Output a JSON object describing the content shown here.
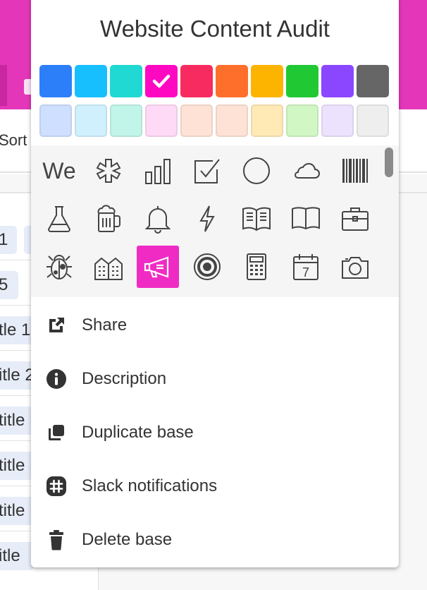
{
  "background": {
    "toolbar_text": "Sort",
    "cells": [
      {
        "text": "1"
      },
      {
        "text": ""
      },
      {
        "text": "5"
      },
      {
        "text": "tle 1"
      },
      {
        "text": "itle 2"
      },
      {
        "text": "title"
      },
      {
        "text": "title"
      },
      {
        "text": "title"
      },
      {
        "text": "itle"
      }
    ]
  },
  "popup": {
    "title": "Website Content Audit",
    "colors": {
      "dark": [
        "#2d7ff9",
        "#18bfff",
        "#20d9d2",
        "#ff08c2",
        "#f82b60",
        "#ff6f2c",
        "#fcb400",
        "#20c933",
        "#8b46ff",
        "#666666"
      ],
      "light": [
        "#cfdfff",
        "#d0f0fd",
        "#c2f5e9",
        "#ffdaf6",
        "#fee2d5",
        "#fee2d5",
        "#ffeab6",
        "#d1f7c4",
        "#ede2fe",
        "#eeeeee"
      ],
      "selected": "#ff08c2"
    },
    "icons": [
      {
        "name": "text-abbrev-icon",
        "text": "We"
      },
      {
        "name": "asterisk-icon"
      },
      {
        "name": "bar-chart-icon"
      },
      {
        "name": "checkbox-icon"
      },
      {
        "name": "circle-icon"
      },
      {
        "name": "cloud-icon"
      },
      {
        "name": "barcode-icon"
      },
      {
        "name": "flask-icon"
      },
      {
        "name": "beer-mug-icon"
      },
      {
        "name": "bell-icon"
      },
      {
        "name": "lightning-icon"
      },
      {
        "name": "open-book-icon"
      },
      {
        "name": "book-icon"
      },
      {
        "name": "briefcase-icon"
      },
      {
        "name": "bug-icon"
      },
      {
        "name": "buildings-icon"
      },
      {
        "name": "megaphone-icon",
        "selected": true
      },
      {
        "name": "target-icon"
      },
      {
        "name": "calculator-icon"
      },
      {
        "name": "calendar-icon",
        "text": "7"
      },
      {
        "name": "camera-icon"
      }
    ],
    "menu": [
      {
        "name": "share-icon",
        "label": "Share"
      },
      {
        "name": "info-icon",
        "label": "Description"
      },
      {
        "name": "duplicate-icon",
        "label": "Duplicate base"
      },
      {
        "name": "slack-icon",
        "label": "Slack notifications"
      },
      {
        "name": "trash-icon",
        "label": "Delete base"
      }
    ]
  }
}
